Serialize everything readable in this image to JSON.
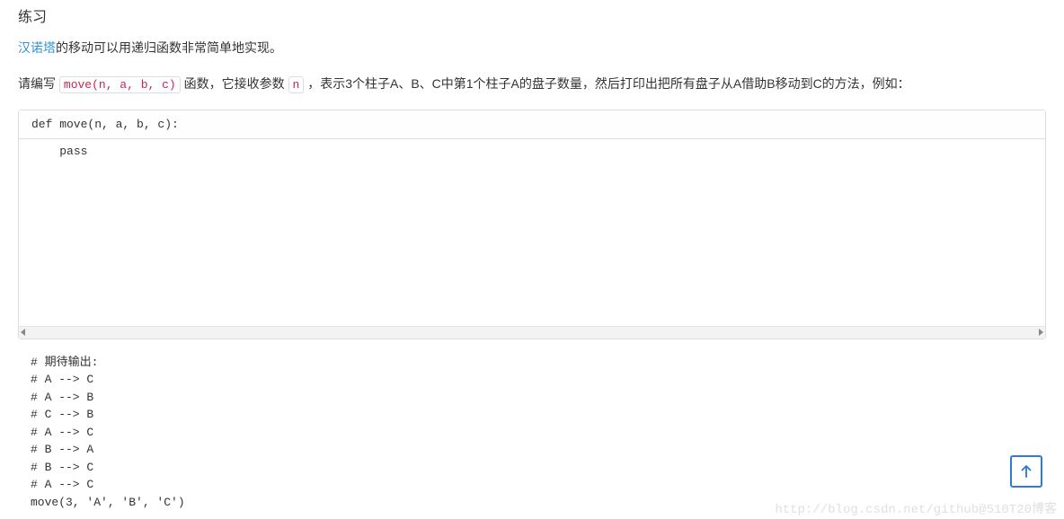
{
  "title": "练习",
  "intro": {
    "link_text": "汉诺塔",
    "rest": "的移动可以用递归函数非常简单地实现。"
  },
  "instruction": {
    "part1": "请编写 ",
    "code1": "move(n, a, b, c)",
    "part2": " 函数，它接收参数 ",
    "code2": "n",
    "part3": " ，表示3个柱子A、B、C中第1个柱子A的盘子数量，然后打印出把所有盘子从A借助B移动到C的方法，例如："
  },
  "code": {
    "signature": "def move(n, a, b, c):",
    "body": "    pass"
  },
  "expected_output": "# 期待输出:\n# A --> C\n# A --> B\n# C --> B\n# A --> C\n# B --> A\n# B --> C\n# A --> C\nmove(3, 'A', 'B', 'C')",
  "watermark": "http://blog.csdn.net/github@510T20博客"
}
